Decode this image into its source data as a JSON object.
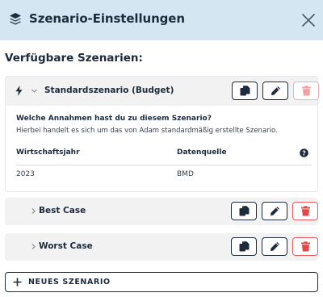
{
  "header": {
    "title": "Szenario-Einstellungen",
    "icon": "layers-icon",
    "close_icon": "close-icon"
  },
  "section_title": "Verfügbare Szenarien:",
  "scenarios": [
    {
      "name": "Standardszenario (Budget)",
      "expanded": true,
      "default": true,
      "question": "Welche Annahmen hast du zu diesem Szenario?",
      "description": "Hierbei handelt es sich um das von Adam standardmäßig erstellte Szenario.",
      "table": {
        "headers": [
          "Wirtschaftsjahr",
          "Datenquelle"
        ],
        "rows": [
          [
            "2023",
            "BMD"
          ]
        ]
      },
      "delete_disabled": true
    },
    {
      "name": "Best Case",
      "expanded": false,
      "delete_disabled": false
    },
    {
      "name": "Worst Case",
      "expanded": false,
      "delete_disabled": false
    }
  ],
  "new_scenario_label": "NEUES SZENARIO",
  "colors": {
    "header_bg": "#d5e6f3",
    "text": "#1d2b3c",
    "danger": "#e35a5a",
    "danger_disabled": "#f2b0b0",
    "card_bg": "#f2f2f2"
  }
}
